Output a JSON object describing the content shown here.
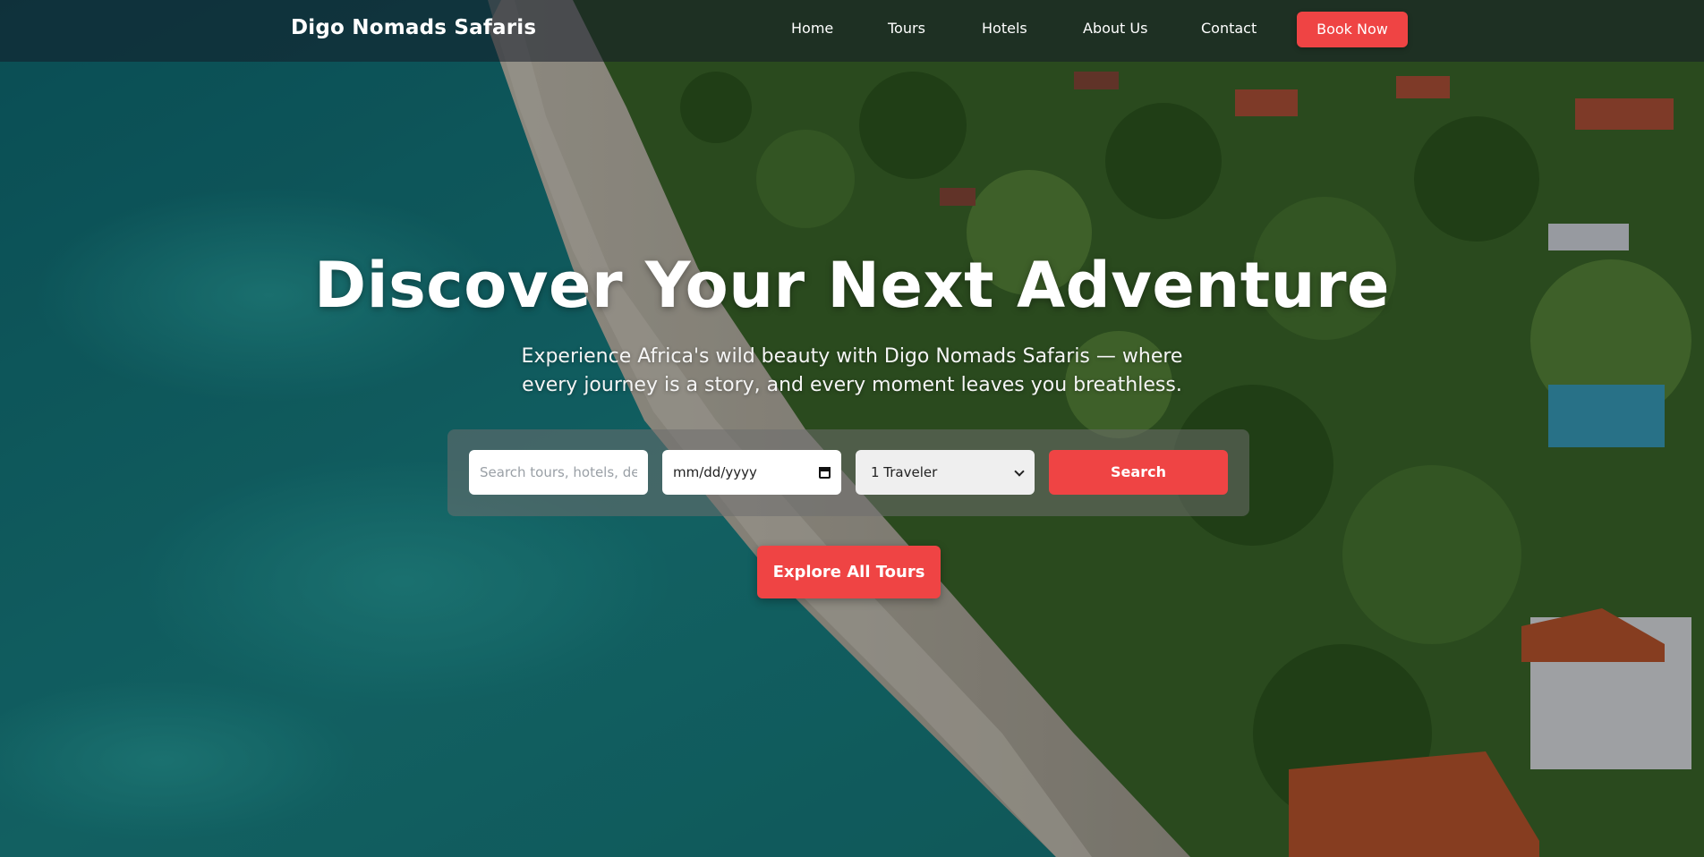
{
  "header": {
    "brand": "Digo Nomads Safaris",
    "nav": {
      "home": "Home",
      "tours": "Tours",
      "hotels": "Hotels",
      "about": "About Us",
      "contact": "Contact"
    },
    "cta_label": "Book Now"
  },
  "hero": {
    "title": "Discover Your Next Adventure",
    "subtitle_line1": "Experience Africa's wild beauty with Digo Nomads Safaris — where",
    "subtitle_line2": "every journey is a story, and every moment leaves you breathless."
  },
  "search": {
    "placeholder": "Search tours, hotels, des",
    "date_value": "mm/dd/yyyy",
    "travelers_value": "1 Traveler",
    "button_label": "Search"
  },
  "explore_label": "Explore All Tours",
  "colors": {
    "accent": "#ef4444",
    "overlay": "#141c28"
  },
  "icons": {
    "date": "calendar-icon",
    "select": "chevron-down-icon"
  }
}
